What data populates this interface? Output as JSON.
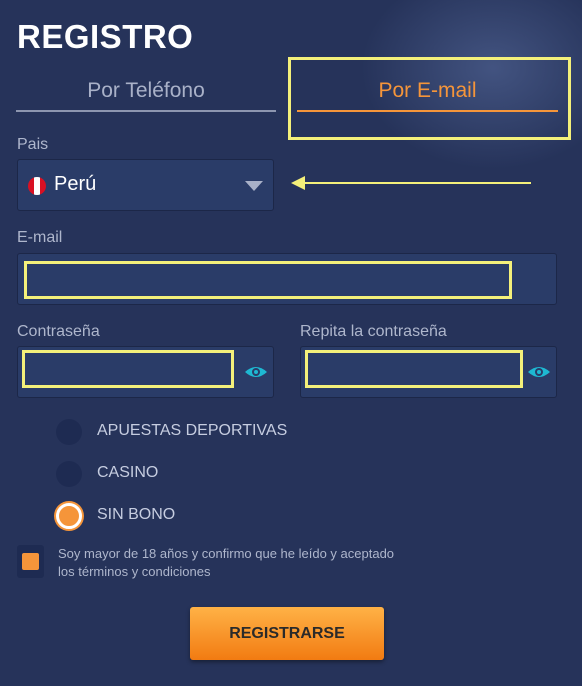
{
  "header": {
    "title": "REGISTRO"
  },
  "tabs": [
    {
      "label": "Por Teléfono",
      "active": false
    },
    {
      "label": "Por E-mail",
      "active": true
    }
  ],
  "country": {
    "label": "Pais",
    "value": "Perú",
    "flag_icon": "peru-flag-icon"
  },
  "email": {
    "label": "E-mail",
    "value": ""
  },
  "password": {
    "label": "Contraseña",
    "value": "",
    "toggle_icon": "eye-icon"
  },
  "password_repeat": {
    "label": "Repita la contraseña",
    "value": "",
    "toggle_icon": "eye-icon"
  },
  "bonus_options": [
    {
      "label": "APUESTAS DEPORTIVAS",
      "selected": false
    },
    {
      "label": "CASINO",
      "selected": false
    },
    {
      "label": "SIN BONO",
      "selected": true
    }
  ],
  "terms": {
    "checked": true,
    "text": "Soy mayor de 18 años y confirmo que he leído y aceptado los términos y condiciones"
  },
  "submit": {
    "label": "REGISTRARSE"
  },
  "colors": {
    "accent": "#f5953a",
    "highlight": "#f4f07a",
    "background": "#26335a",
    "eye": "#1eb8d2"
  }
}
